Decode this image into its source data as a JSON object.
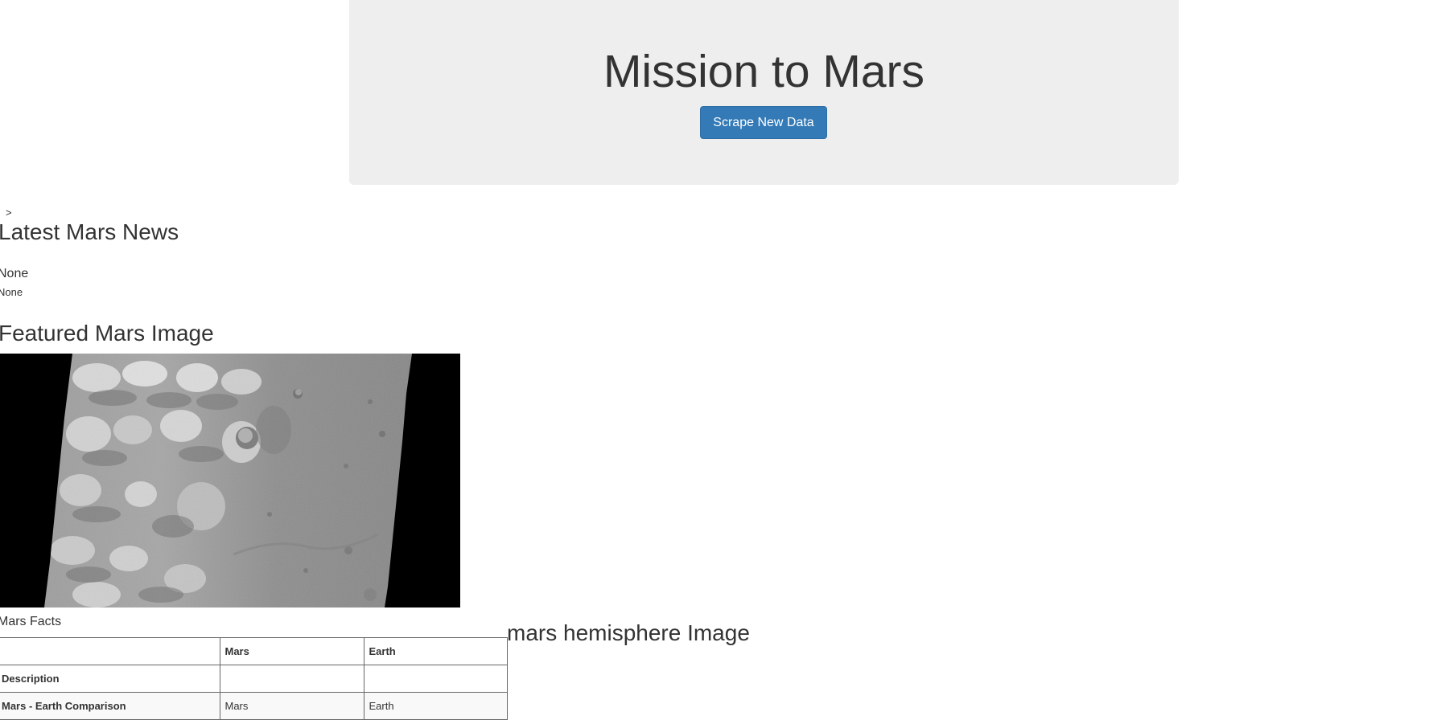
{
  "header": {
    "title": "Mission to Mars",
    "scrape_button_label": "Scrape New Data"
  },
  "stray_text": ">",
  "news": {
    "heading": "Latest Mars News",
    "title": "None",
    "paragraph": "None"
  },
  "featured": {
    "heading": "Featured Mars Image",
    "image_alt": "Featured Mars Image"
  },
  "facts": {
    "caption": "Mars Facts",
    "columns": [
      "",
      "Mars",
      "Earth"
    ],
    "rows": [
      [
        "Description",
        "",
        ""
      ],
      [
        "Mars - Earth Comparison",
        "Mars",
        "Earth"
      ]
    ]
  },
  "hemispheres": {
    "heading": "mars hemisphere Image"
  }
}
